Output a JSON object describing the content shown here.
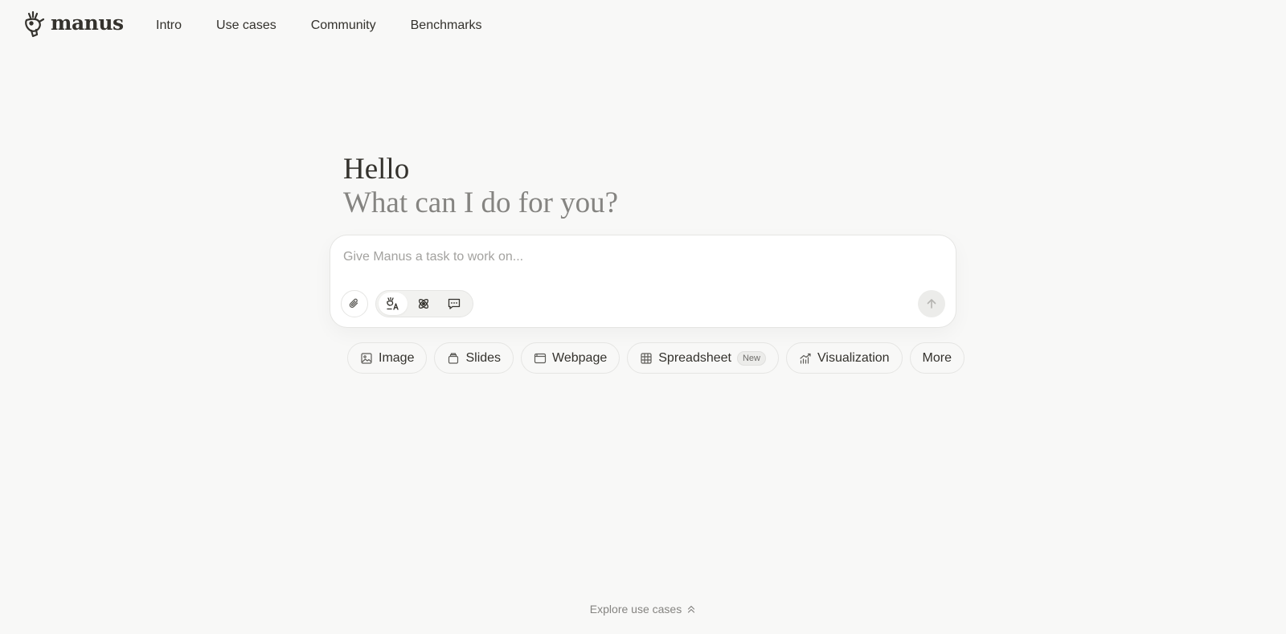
{
  "header": {
    "brand": "manus",
    "nav": [
      {
        "label": "Intro"
      },
      {
        "label": "Use cases"
      },
      {
        "label": "Community"
      },
      {
        "label": "Benchmarks"
      }
    ]
  },
  "hero": {
    "title": "Hello",
    "subtitle": "What can I do for you?"
  },
  "composer": {
    "placeholder": "Give Manus a task to work on...",
    "value": "",
    "attach_icon": "paperclip-icon",
    "modes": [
      {
        "icon": "agent-mode-icon",
        "active": true
      },
      {
        "icon": "atom-mode-icon",
        "active": false
      },
      {
        "icon": "chat-mode-icon",
        "active": false
      }
    ],
    "send_icon": "arrow-up-icon"
  },
  "chips": [
    {
      "label": "Image",
      "icon": "image-icon"
    },
    {
      "label": "Slides",
      "icon": "slides-icon"
    },
    {
      "label": "Webpage",
      "icon": "webpage-icon"
    },
    {
      "label": "Spreadsheet",
      "icon": "table-icon",
      "badge": "New"
    },
    {
      "label": "Visualization",
      "icon": "chart-icon"
    },
    {
      "label": "More"
    }
  ],
  "footer": {
    "explore_label": "Explore use cases",
    "explore_icon": "double-chevron-up-icon"
  },
  "colors": {
    "background": "#f8f8f7",
    "text": "#34322d",
    "muted": "#858481",
    "border": "#e5e5e3"
  }
}
